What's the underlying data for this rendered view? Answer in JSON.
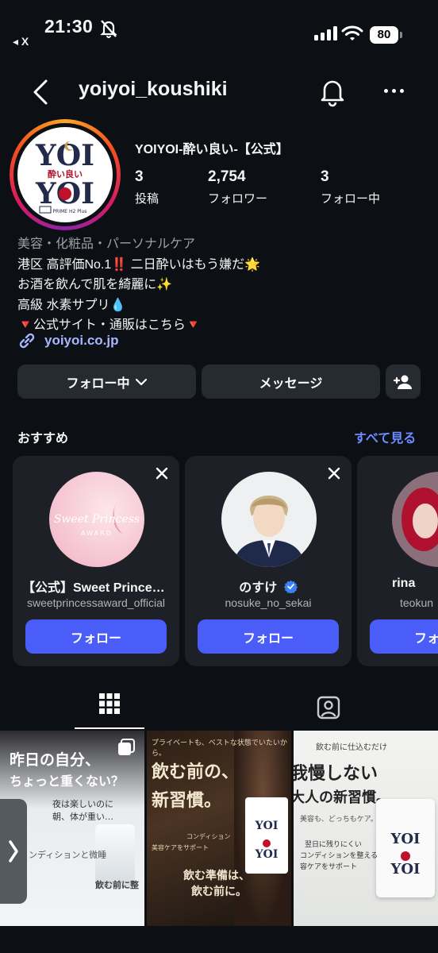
{
  "status_bar": {
    "time": "21:30",
    "back_app": "◂ X",
    "battery": "80"
  },
  "header": {
    "username": "yoiyoi_koushiki"
  },
  "profile": {
    "display_name": "YOIYOI-酔い良い-【公式】",
    "avatar_logo": {
      "line1": "YOI",
      "middle": "酔い良い",
      "line2": "YOI",
      "sub": "PRIME H2 Plus"
    },
    "stats": [
      {
        "value": "3",
        "label": "投稿"
      },
      {
        "value": "2,754",
        "label": "フォロワー"
      },
      {
        "value": "3",
        "label": "フォロー中"
      }
    ],
    "bio": {
      "category": "美容・化粧品・パーソナルケア",
      "lines": [
        "港区 高評価No.1‼️ 二日酔いはもう嫌だ🌟",
        "お酒を飲んで肌を綺麗に✨",
        "高級 水素サプリ💧",
        "🔻公式サイト・通販はこちら🔻"
      ]
    },
    "link": "yoiyoi.co.jp"
  },
  "actions": {
    "following": "フォロー中",
    "message": "メッセージ"
  },
  "recommended": {
    "title": "おすすめ",
    "see_all": "すべて見る",
    "cards": [
      {
        "name": "【公式】Sweet Princess Award",
        "handle": "sweetprincessaward_official",
        "pic_text": "Sweet Princess",
        "pic_sub": "AWARD",
        "follow": "フォロー"
      },
      {
        "name": "のすけ",
        "handle": "nosuke_no_sekai",
        "verified": true,
        "follow": "フォロー"
      },
      {
        "name": "rina",
        "handle": "teokun",
        "follow": "フォロー"
      }
    ]
  },
  "posts": [
    {
      "headline": "昨日の自分、",
      "sub": "ちょっと重くない？",
      "lines": [
        "夜は楽しいのに",
        "朝、体が重い…",
        "ンディションと微睡",
        "飲む前に整"
      ]
    },
    {
      "top": "プライベートも、ベストな状態でいたいから。",
      "headline": "飲む前の、",
      "sub": "新習慣。",
      "lines": [
        "コンディション",
        "美容ケアをサポート",
        "飲む準備は、",
        "飲む前に。"
      ]
    },
    {
      "top": "飲む前に仕込むだけ",
      "headline": "我慢しない",
      "sub": "大人の新習慣。",
      "lines": [
        "美容も、どっちもケア。",
        "翌日に残りにくい",
        "コンディションを整える",
        "容ケアをサポート"
      ]
    }
  ],
  "colors": {
    "accent": "#4a5df9",
    "link": "#a7b7ff",
    "see_all": "#6c8cff",
    "background": "#0c0f14",
    "card": "#1d2026"
  }
}
